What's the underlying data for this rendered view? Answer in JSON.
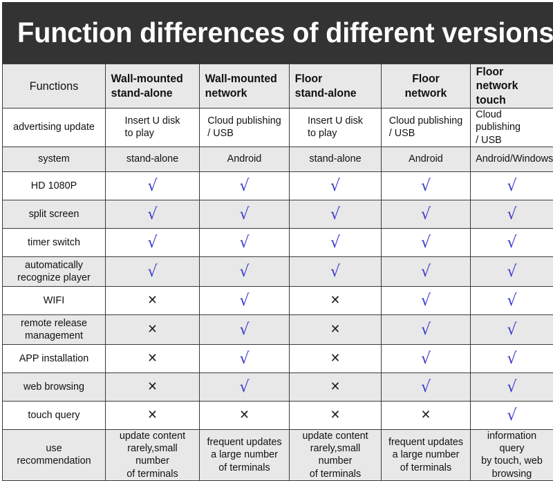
{
  "banner": {
    "title": "Function differences of different versions",
    "background_color": "#333333",
    "text_color": "#ffffff"
  },
  "colors": {
    "check": "#3b3bce",
    "cross": "#1a1a1a",
    "shaded_row": "#e8e8e8",
    "plain_row": "#ffffff",
    "border": "#3a3a3a"
  },
  "symbols": {
    "check": "√",
    "cross": "✕"
  },
  "table": {
    "columns": [
      {
        "key": "functions",
        "label": "Functions",
        "align": "center"
      },
      {
        "key": "wall_stand_alone",
        "label_line1": "Wall-mounted",
        "label_line2": "stand-alone",
        "align": "left"
      },
      {
        "key": "wall_network",
        "label_line1": "Wall-mounted",
        "label_line2": "network",
        "align": "left"
      },
      {
        "key": "floor_stand_alone",
        "label_line1": "Floor",
        "label_line2": "stand-alone",
        "align": "left"
      },
      {
        "key": "floor_network",
        "label_line1": "Floor",
        "label_line2": "network",
        "align": "center"
      },
      {
        "key": "floor_network_touch",
        "label_line1": "Floor",
        "label_line2": "network touch",
        "align": "left"
      }
    ],
    "rows": [
      {
        "label": "advertising update",
        "shaded": false,
        "type": "text",
        "cells": [
          {
            "line1": "Insert U disk",
            "line2": "to play"
          },
          {
            "line1": "Cloud publishing",
            "line2": "/ USB"
          },
          {
            "line1": "Insert U disk",
            "line2": "to play"
          },
          {
            "line1": "Cloud publishing",
            "line2": "/ USB"
          },
          {
            "line1": "Cloud publishing",
            "line2": "/ USB"
          }
        ]
      },
      {
        "label": "system",
        "shaded": true,
        "type": "text",
        "cells": [
          {
            "line1": "stand-alone"
          },
          {
            "line1": "Android"
          },
          {
            "line1": "stand-alone"
          },
          {
            "line1": "Android"
          },
          {
            "line1": "Android/Windows"
          }
        ]
      },
      {
        "label": "HD 1080P",
        "shaded": false,
        "type": "mark",
        "marks": [
          "check",
          "check",
          "check",
          "check",
          "check"
        ]
      },
      {
        "label": "split screen",
        "shaded": true,
        "type": "mark",
        "marks": [
          "check",
          "check",
          "check",
          "check",
          "check"
        ]
      },
      {
        "label": "timer switch",
        "shaded": false,
        "type": "mark",
        "marks": [
          "check",
          "check",
          "check",
          "check",
          "check"
        ]
      },
      {
        "label_line1": "automatically",
        "label_line2": "recognize player",
        "shaded": true,
        "type": "mark",
        "marks": [
          "check",
          "check",
          "check",
          "check",
          "check"
        ]
      },
      {
        "label": "WIFI",
        "shaded": false,
        "type": "mark",
        "marks": [
          "cross",
          "check",
          "cross",
          "check",
          "check"
        ]
      },
      {
        "label_line1": "remote release",
        "label_line2": "management",
        "shaded": true,
        "type": "mark",
        "marks": [
          "cross",
          "check",
          "cross",
          "check",
          "check"
        ]
      },
      {
        "label": "APP installation",
        "shaded": false,
        "type": "mark",
        "marks": [
          "cross",
          "check",
          "cross",
          "check",
          "check"
        ]
      },
      {
        "label": "web browsing",
        "shaded": true,
        "type": "mark",
        "marks": [
          "cross",
          "check",
          "cross",
          "check",
          "check"
        ]
      },
      {
        "label": "touch query",
        "shaded": false,
        "type": "mark",
        "marks": [
          "cross",
          "cross",
          "cross",
          "cross",
          "check"
        ]
      },
      {
        "label_line1": "use",
        "label_line2": "recommendation",
        "shaded": true,
        "type": "text",
        "cells": [
          {
            "line1": "update content",
            "line2": "rarely,small number",
            "line3": "of terminals"
          },
          {
            "line1": "frequent updates",
            "line2": "a large number",
            "line3": "of terminals"
          },
          {
            "line1": "update content",
            "line2": "rarely,small number",
            "line3": "of terminals"
          },
          {
            "line1": "frequent updates",
            "line2": "a large number",
            "line3": "of terminals"
          },
          {
            "line1": "information query",
            "line2": "by touch, web",
            "line3": "browsing"
          }
        ]
      }
    ]
  }
}
